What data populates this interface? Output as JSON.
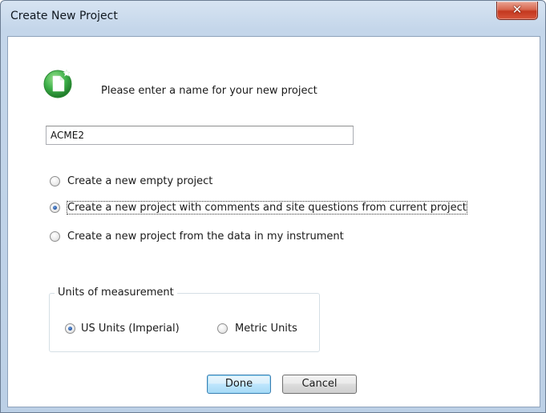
{
  "window": {
    "title": "Create New Project",
    "close_glyph": "✕"
  },
  "header": {
    "icon": "new-document-icon",
    "prompt": "Please enter a name for your new project"
  },
  "project_name": {
    "value": "ACME2",
    "placeholder": ""
  },
  "options": [
    {
      "label": "Create a new empty project",
      "selected": false
    },
    {
      "label": "Create a new project with comments and site questions from current project",
      "selected": true
    },
    {
      "label": "Create a new project from the data in my instrument",
      "selected": false
    }
  ],
  "units": {
    "legend": "Units of measurement",
    "imperial": {
      "label": "US Units (Imperial)",
      "selected": true
    },
    "metric": {
      "label": "Metric Units",
      "selected": false
    }
  },
  "buttons": {
    "done": "Done",
    "cancel": "Cancel"
  },
  "colors": {
    "icon_green": "#3fb24a",
    "title_bar": "#c4d6ea",
    "close_red": "#c4381f",
    "default_button_border": "#3c7fb1"
  }
}
